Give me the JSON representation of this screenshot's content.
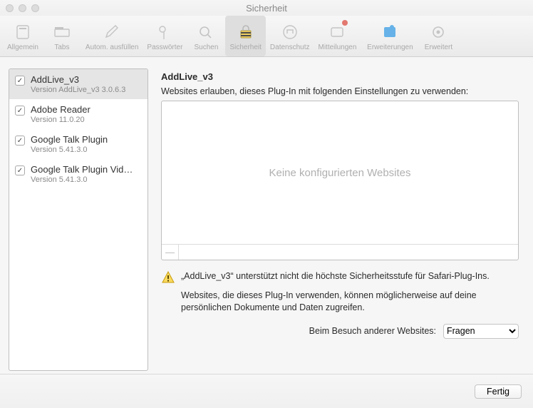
{
  "window": {
    "title": "Sicherheit"
  },
  "toolbar": [
    {
      "id": "allgemein",
      "label": "Allgemein"
    },
    {
      "id": "tabs",
      "label": "Tabs"
    },
    {
      "id": "autofill",
      "label": "Autom. ausfüllen"
    },
    {
      "id": "passwoerter",
      "label": "Passwörter"
    },
    {
      "id": "suchen",
      "label": "Suchen"
    },
    {
      "id": "sicherheit",
      "label": "Sicherheit"
    },
    {
      "id": "datenschutz",
      "label": "Datenschutz"
    },
    {
      "id": "mitteilungen",
      "label": "Mitteilungen"
    },
    {
      "id": "erweiterungen",
      "label": "Erweiterungen"
    },
    {
      "id": "erweitert",
      "label": "Erweitert"
    }
  ],
  "plugins": [
    {
      "name": "AddLive_v3",
      "version": "Version AddLive_v3 3.0.6.3",
      "checked": true,
      "selected": true
    },
    {
      "name": "Adobe Reader",
      "version": "Version 11.0.20",
      "checked": true,
      "selected": false
    },
    {
      "name": "Google Talk Plugin",
      "version": "Version 5.41.3.0",
      "checked": true,
      "selected": false
    },
    {
      "name": "Google Talk Plugin Vid…",
      "version": "Version 5.41.3.0",
      "checked": true,
      "selected": false
    }
  ],
  "detail": {
    "title": "AddLive_v3",
    "subtitle": "Websites erlauben, dieses Plug-In mit folgenden Einstellungen zu verwenden:",
    "empty_list_text": "Keine konfigurierten Websites",
    "remove_label": "—",
    "warning_line1": "„AddLive_v3“ unterstützt nicht die höchste Sicherheitsstufe für Safari-Plug-Ins.",
    "warning_line2": "Websites, die dieses Plug-In verwenden, können möglicherweise auf deine persönlichen Dokumente und Daten zugreifen.",
    "policy_label": "Beim Besuch anderer Websites:",
    "policy_value": "Fragen"
  },
  "footer": {
    "done": "Fertig"
  }
}
